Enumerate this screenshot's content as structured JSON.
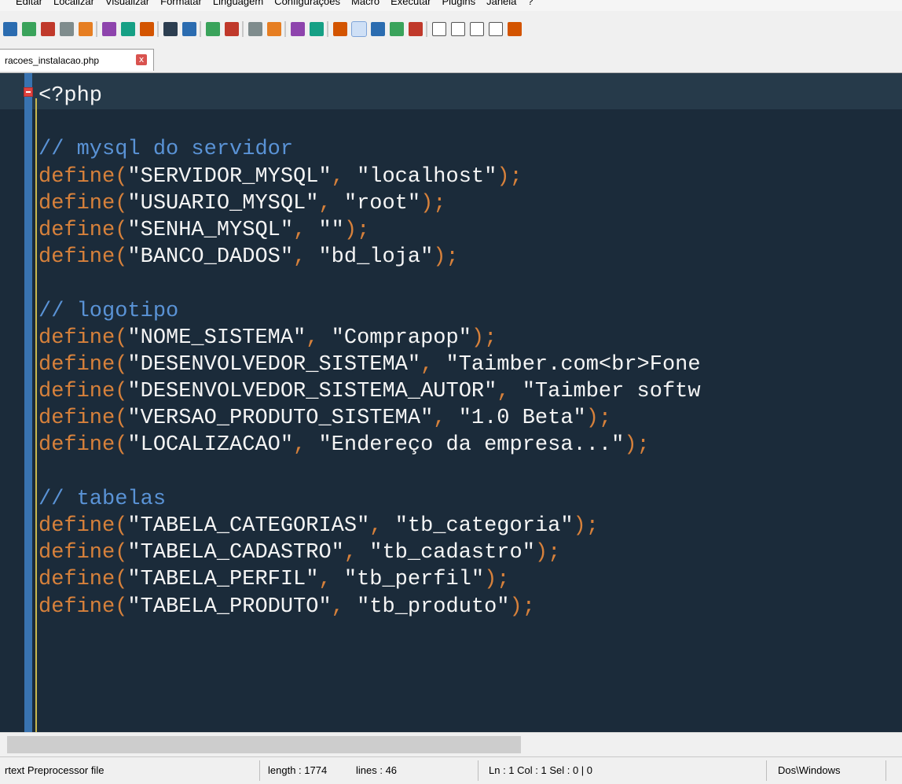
{
  "menu": {
    "items": [
      "Editar",
      "Localizar",
      "Visualizar",
      "Formatar",
      "Linguagem",
      "Configurações",
      "Macro",
      "Executar",
      "Plugins",
      "Janela",
      "?"
    ]
  },
  "toolbar": {
    "buttons": [
      "save-all",
      "close",
      "close-all",
      "print",
      "cut",
      "copy",
      "paste",
      "undo",
      "redo",
      "find",
      "replace",
      "zoom-in",
      "zoom-out",
      "sync-v",
      "sync-h",
      "word-wrap",
      "show-all-chars",
      "indent-guide",
      "udl",
      "doc-map",
      "function-list",
      "record-macro",
      "stop-record",
      "play-macro",
      "run-macro-multiple",
      "save-macro"
    ]
  },
  "tab": {
    "label": "racoes_instalacao.php",
    "close": "x"
  },
  "editor": {
    "lines": [
      [
        {
          "t": "<?php",
          "c": "str"
        }
      ],
      [],
      [
        {
          "t": "// mysql do servidor",
          "c": "cmt"
        }
      ],
      [
        {
          "t": "define(",
          "c": "fn"
        },
        {
          "t": "\"SERVIDOR_MYSQL\"",
          "c": "str"
        },
        {
          "t": ", ",
          "c": "pn"
        },
        {
          "t": "\"localhost\"",
          "c": "str"
        },
        {
          "t": ");",
          "c": "pn"
        }
      ],
      [
        {
          "t": "define(",
          "c": "fn"
        },
        {
          "t": "\"USUARIO_MYSQL\"",
          "c": "str"
        },
        {
          "t": ", ",
          "c": "pn"
        },
        {
          "t": "\"root\"",
          "c": "str"
        },
        {
          "t": ");",
          "c": "pn"
        }
      ],
      [
        {
          "t": "define(",
          "c": "fn"
        },
        {
          "t": "\"SENHA_MYSQL\"",
          "c": "str"
        },
        {
          "t": ", ",
          "c": "pn"
        },
        {
          "t": "\"\"",
          "c": "str"
        },
        {
          "t": ");",
          "c": "pn"
        }
      ],
      [
        {
          "t": "define(",
          "c": "fn"
        },
        {
          "t": "\"BANCO_DADOS\"",
          "c": "str"
        },
        {
          "t": ", ",
          "c": "pn"
        },
        {
          "t": "\"bd_loja\"",
          "c": "str"
        },
        {
          "t": ");",
          "c": "pn"
        }
      ],
      [],
      [
        {
          "t": "// logotipo",
          "c": "cmt"
        }
      ],
      [
        {
          "t": "define(",
          "c": "fn"
        },
        {
          "t": "\"NOME_SISTEMA\"",
          "c": "str"
        },
        {
          "t": ", ",
          "c": "pn"
        },
        {
          "t": "\"Comprapop\"",
          "c": "str"
        },
        {
          "t": ");",
          "c": "pn"
        }
      ],
      [
        {
          "t": "define(",
          "c": "fn"
        },
        {
          "t": "\"DESENVOLVEDOR_SISTEMA\"",
          "c": "str"
        },
        {
          "t": ", ",
          "c": "pn"
        },
        {
          "t": "\"Taimber.com<br>Fone",
          "c": "str"
        }
      ],
      [
        {
          "t": "define(",
          "c": "fn"
        },
        {
          "t": "\"DESENVOLVEDOR_SISTEMA_AUTOR\"",
          "c": "str"
        },
        {
          "t": ", ",
          "c": "pn"
        },
        {
          "t": "\"Taimber softw",
          "c": "str"
        }
      ],
      [
        {
          "t": "define(",
          "c": "fn"
        },
        {
          "t": "\"VERSAO_PRODUTO_SISTEMA\"",
          "c": "str"
        },
        {
          "t": ", ",
          "c": "pn"
        },
        {
          "t": "\"1.0 Beta\"",
          "c": "str"
        },
        {
          "t": ");",
          "c": "pn"
        }
      ],
      [
        {
          "t": "define(",
          "c": "fn"
        },
        {
          "t": "\"LOCALIZACAO\"",
          "c": "str"
        },
        {
          "t": ", ",
          "c": "pn"
        },
        {
          "t": "\"Endereço da empresa...\"",
          "c": "str"
        },
        {
          "t": ");",
          "c": "pn"
        }
      ],
      [],
      [
        {
          "t": "// tabelas",
          "c": "cmt"
        }
      ],
      [
        {
          "t": "define(",
          "c": "fn"
        },
        {
          "t": "\"TABELA_CATEGORIAS\"",
          "c": "str"
        },
        {
          "t": ", ",
          "c": "pn"
        },
        {
          "t": "\"tb_categoria\"",
          "c": "str"
        },
        {
          "t": ");",
          "c": "pn"
        }
      ],
      [
        {
          "t": "define(",
          "c": "fn"
        },
        {
          "t": "\"TABELA_CADASTRO\"",
          "c": "str"
        },
        {
          "t": ", ",
          "c": "pn"
        },
        {
          "t": "\"tb_cadastro\"",
          "c": "str"
        },
        {
          "t": ");",
          "c": "pn"
        }
      ],
      [
        {
          "t": "define(",
          "c": "fn"
        },
        {
          "t": "\"TABELA_PERFIL\"",
          "c": "str"
        },
        {
          "t": ", ",
          "c": "pn"
        },
        {
          "t": "\"tb_perfil\"",
          "c": "str"
        },
        {
          "t": ");",
          "c": "pn"
        }
      ],
      [
        {
          "t": "define(",
          "c": "fn"
        },
        {
          "t": "\"TABELA_PRODUTO\"",
          "c": "str"
        },
        {
          "t": ", ",
          "c": "pn"
        },
        {
          "t": "\"tb_produto\"",
          "c": "str"
        },
        {
          "t": ");",
          "c": "pn"
        }
      ]
    ]
  },
  "status": {
    "filetype": "rtext Preprocessor file",
    "length": "length : 1774",
    "lines": "lines : 46",
    "position": "Ln : 1    Col : 1    Sel : 0 | 0",
    "eol": "Dos\\Windows"
  }
}
